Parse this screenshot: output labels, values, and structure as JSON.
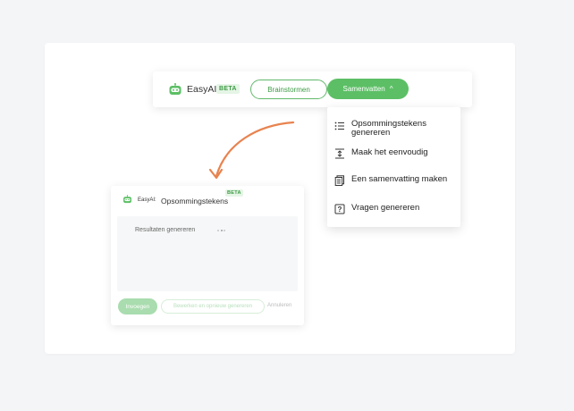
{
  "toolbar": {
    "brand": "EasyAI",
    "beta": "BETA",
    "brainstorm_label": "Brainstormen",
    "summarize_label": "Samenvatten",
    "summarize_caret": "^",
    "accent_color": "#5cbf65"
  },
  "dropdown": {
    "items": [
      {
        "label": "Opsommingstekens genereren",
        "icon": "list-icon"
      },
      {
        "label": "Maak het eenvoudig",
        "icon": "simplify-icon"
      },
      {
        "label": "Een samenvatting maken",
        "icon": "document-icon"
      },
      {
        "label": "Vragen genereren",
        "icon": "question-icon"
      }
    ]
  },
  "panel": {
    "brand": "EasyAI:",
    "title": "Opsommingstekens",
    "beta": "BETA",
    "status": "Resultaten genereren",
    "insert_label": "Invoegen",
    "edit_label": "Bewerken en opnieuw genereren",
    "cancel_label": "Annuleren"
  },
  "arrow_color": "#e8834f"
}
